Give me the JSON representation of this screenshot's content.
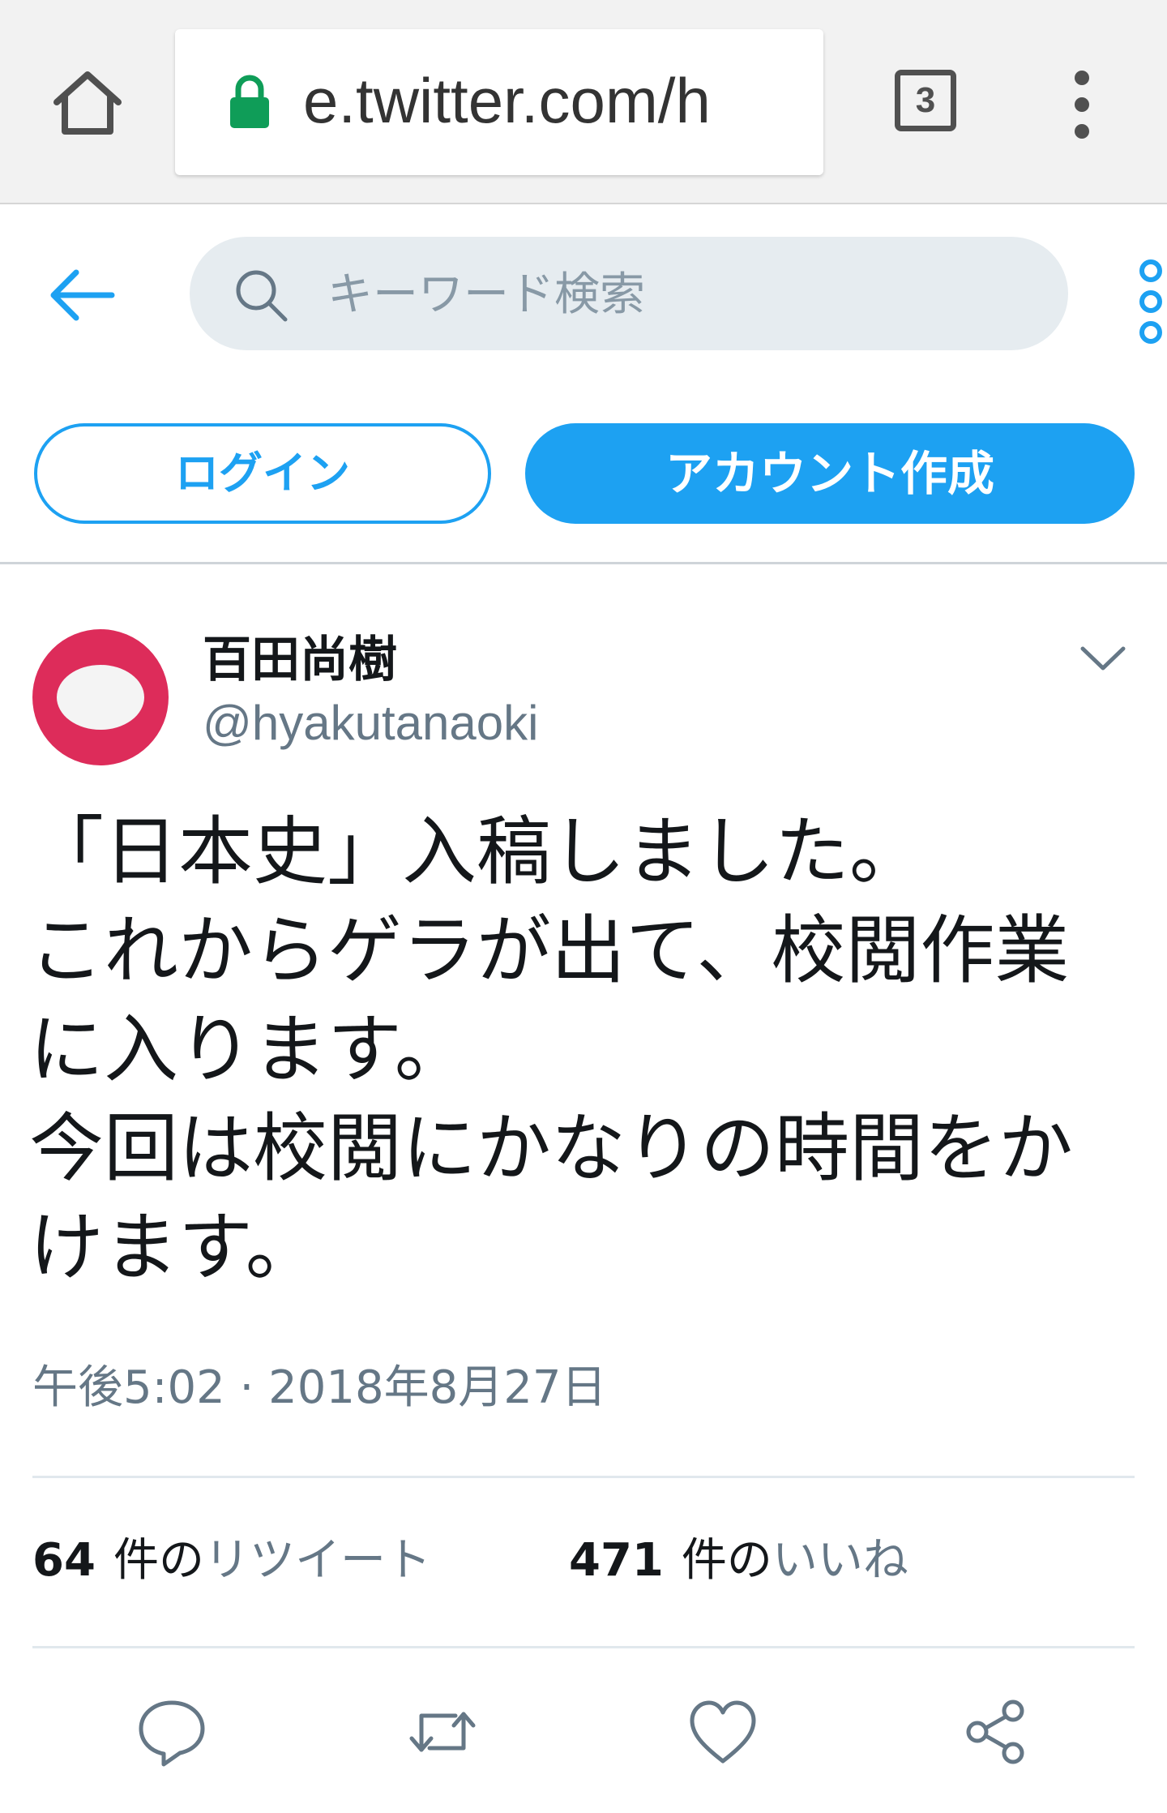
{
  "browser": {
    "url_text": "e.twitter.com/h",
    "tab_count": "3",
    "icons": {
      "home": "home-icon",
      "lock": "lock-icon",
      "menu": "vertical-dots-icon"
    },
    "secure_color": "#0f9d58"
  },
  "header": {
    "search_placeholder": "キーワード検索",
    "login_label": "ログイン",
    "signup_label": "アカウント作成",
    "accent_color": "#1da1f2"
  },
  "tweet": {
    "display_name": "百田尚樹",
    "screen_name": "@hyakutanaoki",
    "text_lines": [
      "「日本史」入稿しました。",
      "これからゲラが出て、校閲作業",
      "に入ります。",
      "今回は校閲にかなりの時間をか",
      "けます。"
    ],
    "timestamp": "午後5:02 · 2018年8月27日",
    "retweets": {
      "count": "64",
      "unit": "件の",
      "label": "リツイート"
    },
    "likes": {
      "count": "471",
      "unit": "件の",
      "label": "いいね"
    },
    "avatar_color": "#dd2c5a"
  },
  "actions": [
    {
      "name": "reply-icon"
    },
    {
      "name": "retweet-icon"
    },
    {
      "name": "like-icon"
    },
    {
      "name": "share-icon"
    }
  ]
}
